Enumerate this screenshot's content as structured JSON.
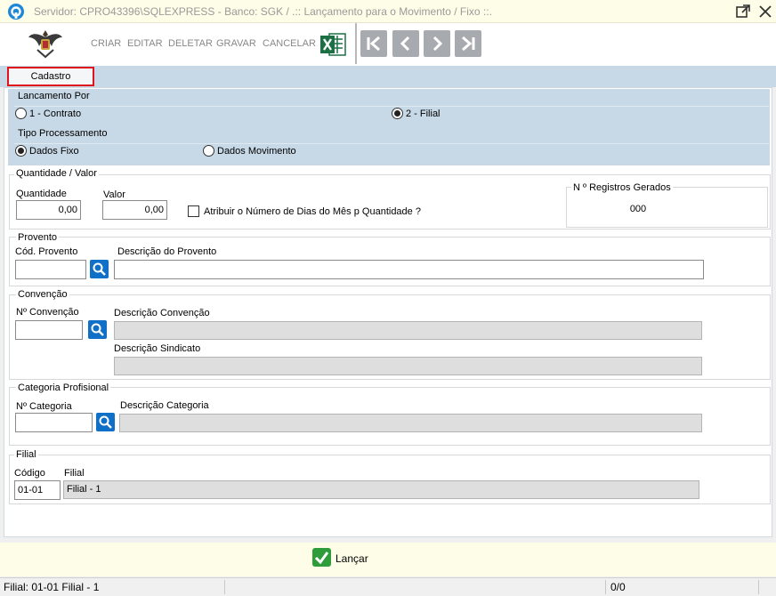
{
  "window": {
    "title": "Servidor: CPRO43396\\SQLEXPRESS - Banco: SGK / .:: Lançamento para o Movimento / Fixo ::.",
    "app_icon": "app-logo-icon",
    "restore_icon": "popout-icon",
    "close_icon": "close-icon"
  },
  "toolbar": {
    "logo": "eagle-crest-logo",
    "buttons": [
      "CRIAR",
      "EDITAR",
      "DELETAR",
      "GRAVAR",
      "CANCELAR"
    ],
    "excel_icon": "excel-icon",
    "nav": [
      "first-record-icon",
      "previous-record-icon",
      "next-record-icon",
      "last-record-icon"
    ]
  },
  "tabs": [
    "Cadastro"
  ],
  "lancamento": {
    "label": "Lancamento Por",
    "options": [
      "1 - Contrato",
      "2 - Filial"
    ],
    "selected": "2 - Filial"
  },
  "tipo": {
    "label": "Tipo Processamento",
    "options": [
      "Dados Fixo",
      "Dados Movimento"
    ],
    "selected": "Dados Fixo"
  },
  "quantidade_valor": {
    "label": "Quantidade / Valor",
    "quantidade_label": "Quantidade",
    "quantidade_value": "0,00",
    "valor_label": "Valor",
    "valor_value": "0,00",
    "checkbox_label": "Atribuir o Número de Dias do Mês p Quantidade ?",
    "checkbox_checked": false
  },
  "registros": {
    "label": "N º Registros Gerados",
    "value": "000"
  },
  "provento": {
    "label": "Provento",
    "cod_label": "Cód. Provento",
    "cod_value": "",
    "desc_label": "Descrição do Provento",
    "desc_value": ""
  },
  "convencao": {
    "label": "Convenção",
    "num_label": "Nº Convenção",
    "num_value": "",
    "desc_label": "Descrição Convenção",
    "desc_value": "",
    "sind_label": "Descrição Sindicato",
    "sind_value": ""
  },
  "categoria": {
    "label": "Categoria Profisional",
    "num_label": "Nº Categoria",
    "num_value": "",
    "desc_label": "Descrição Categoria",
    "desc_value": ""
  },
  "filial": {
    "label": "Filial",
    "codigo_label": "Código",
    "codigo_value": "01-01",
    "filial_label": "Filial",
    "filial_value": "Filial - 1"
  },
  "footer": {
    "lancar_label": "Lançar",
    "lancar_icon": "check-icon"
  },
  "status": {
    "filial": "Filial: 01-01 Filial - 1",
    "records": "0/0"
  },
  "colors": {
    "band": "#c7d8e6",
    "title_bg": "#fdfde8",
    "tab_highlight": "#e0141b",
    "search_button": "#1070c8",
    "excel_green": "#1d7044",
    "check_green": "#2e9c3a"
  }
}
